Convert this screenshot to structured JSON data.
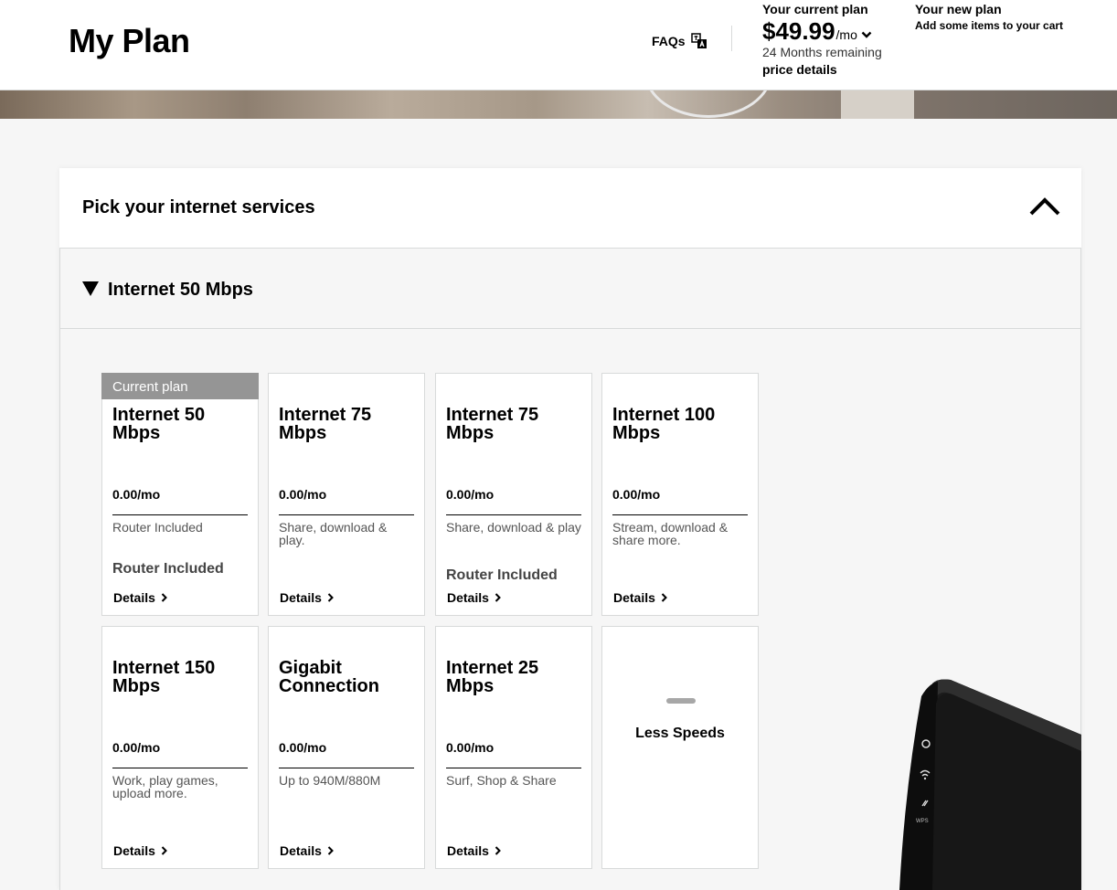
{
  "header": {
    "title": "My Plan",
    "faqs_label": "FAQs",
    "current_plan": {
      "label": "Your current plan",
      "price": "$49.99",
      "per": "/mo",
      "months_remaining": "24 Months remaining",
      "price_details": "price details"
    },
    "new_plan": {
      "label": "Your new plan",
      "sub": "Add some items to your cart"
    }
  },
  "section": {
    "title": "Pick your internet services",
    "group_title": "Internet 50 Mbps"
  },
  "tiles": [
    {
      "badge": "Current plan",
      "name": "Internet 50 Mbps",
      "price": "0.00/mo",
      "desc": "Router Included",
      "extra": "Router Included",
      "details": "Details"
    },
    {
      "name": "Internet 75 Mbps",
      "price": "0.00/mo",
      "desc": "Share, download & play.",
      "details": "Details"
    },
    {
      "name": "Internet 75 Mbps",
      "price": "0.00/mo",
      "desc": "Share, download & play",
      "extra": "Router Included",
      "details": "Details"
    },
    {
      "name": "Internet 100 Mbps",
      "price": "0.00/mo",
      "desc": "Stream, download & share more.",
      "details": "Details"
    },
    {
      "name": "Internet 150 Mbps",
      "price": "0.00/mo",
      "desc": "Work, play games, upload more.",
      "details": "Details"
    },
    {
      "name": "Gigabit Connection",
      "price": "0.00/mo",
      "desc": "Up to 940M/880M",
      "details": "Details"
    },
    {
      "name": "Internet 25 Mbps",
      "price": "0.00/mo",
      "desc": "Surf, Shop & Share",
      "details": "Details"
    }
  ],
  "less_speeds": "Less Speeds",
  "icons": {
    "faqs": "translate-icon",
    "price_toggle": "chevron-down-icon",
    "collapse": "chevron-up-icon",
    "group_toggle": "triangle-down-icon",
    "details": "chevron-right-icon"
  },
  "colors": {
    "badge": "#959595",
    "border": "#d8dada",
    "background": "#f6f6f6"
  }
}
